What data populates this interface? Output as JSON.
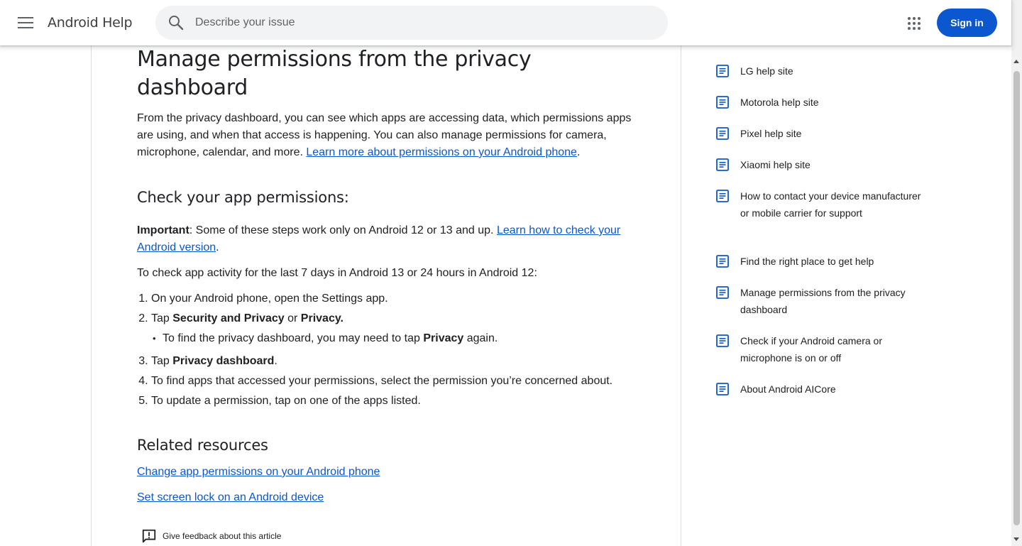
{
  "header": {
    "app_title": "Android Help",
    "search_placeholder": "Describe your issue",
    "signin_label": "Sign in"
  },
  "article": {
    "title": "Manage permissions from the privacy dashboard",
    "intro": "From the privacy dashboard, you can see which apps are accessing data, which permissions apps are using, and when that access is happening. You can also manage permissions for camera, microphone, calendar, and more. ",
    "intro_link": "Learn more about permissions on your Android phone",
    "check_heading": "Check your app permissions:",
    "important_label": "Important",
    "important_text": ": Some of these steps work only on Android 12 or 13 and up. ",
    "important_link": "Learn how to check your Android version",
    "check_text": "To check app activity for the last 7 days in Android 13 or 24 hours in Android 12:",
    "steps": {
      "s1": "On your Android phone, open the Settings app.",
      "s2_a": "Tap ",
      "s2_b": "Security and Privacy",
      "s2_c": " or ",
      "s2_d": "Privacy.",
      "s2_sub_a": "To find the privacy dashboard, you may need to tap ",
      "s2_sub_b": "Privacy",
      "s2_sub_c": " again.",
      "s3_a": "Tap ",
      "s3_b": "Privacy dashboard",
      "s3_c": ".",
      "s4": "To find apps that accessed your permissions, select the permission you’re concerned about.",
      "s5": "To update a permission, tap on one of the apps listed."
    },
    "related_heading": "Related resources",
    "related_links": [
      "Change app permissions on your Android phone",
      "Set screen lock on an Android device"
    ],
    "feedback_label": "Give feedback about this article"
  },
  "sidebar": {
    "items": [
      "LG help site",
      "Motorola help site",
      "Pixel help site",
      "Xiaomi help site",
      "How to contact your device manufacturer or mobile carrier for support",
      "Find the right place to get help",
      "Manage permissions from the privacy dashboard",
      "Check if your Android camera or microphone is on or off",
      "About Android AICore"
    ]
  },
  "colors": {
    "link": "#0b57d0",
    "primary_button": "#0b57d0",
    "search_bg": "#f1f3f4",
    "icon_blue": "#0b57d0"
  }
}
